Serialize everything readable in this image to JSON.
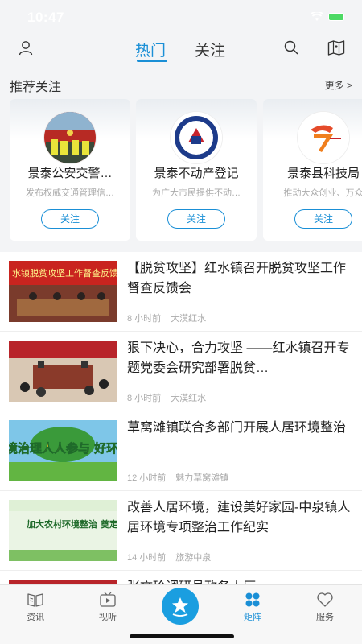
{
  "status": {
    "time": "10:47"
  },
  "nav": {
    "tabs": [
      {
        "label": "热门",
        "active": true
      },
      {
        "label": "关注",
        "active": false
      }
    ]
  },
  "recommend": {
    "title": "推荐关注",
    "more": "更多 >",
    "cards": [
      {
        "name": "景泰公安交警…",
        "desc": "发布权威交通管理信…",
        "button": "关注"
      },
      {
        "name": "景泰不动产登记",
        "desc": "为广大市民提供不动…",
        "button": "关注"
      },
      {
        "name": "景泰县科技局",
        "desc": "推动大众创业、万众",
        "button": "关注"
      }
    ]
  },
  "news": [
    {
      "title": "【脱贫攻坚】红水镇召开脱贫攻坚工作督查反馈会",
      "time": "8 小时前",
      "source": "大漠红水",
      "thumb_text": "水镇脱贫攻坚工作督查反馈"
    },
    {
      "title": "狠下决心，合力攻坚 ——红水镇召开专题党委会研究部署脱贫…",
      "time": "8 小时前",
      "source": "大漠红水",
      "thumb_text": ""
    },
    {
      "title": "草窝滩镇联合多部门开展人居环境整治",
      "time": "12 小时前",
      "source": "魅力草窝滩镇",
      "thumb_text": "境治理人人参与 好环境家家享受"
    },
    {
      "title": "改善人居环境，建设美好家园-中泉镇人居环境专项整治工作纪实",
      "time": "14 小时前",
      "source": "旅游中泉",
      "thumb_text": "加大农村环境整治 奠定乡村振兴基础"
    },
    {
      "title": "张文玲调研县政务大厅",
      "time": "",
      "source": "",
      "thumb_text": ""
    }
  ],
  "tabbar": {
    "items": [
      {
        "label": "资讯",
        "icon": "news-book-icon"
      },
      {
        "label": "视听",
        "icon": "tv-icon"
      },
      {
        "label": "",
        "icon": "home-star-icon"
      },
      {
        "label": "矩阵",
        "icon": "matrix-icon",
        "active": true
      },
      {
        "label": "服务",
        "icon": "heart-icon"
      }
    ]
  },
  "colors": {
    "accent": "#1a8fd6",
    "background": "#f3f4f6"
  }
}
